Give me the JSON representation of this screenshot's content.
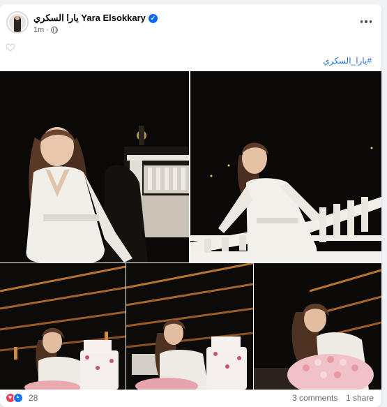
{
  "post": {
    "author_name": "يارا السكري Yara Elsokkary",
    "verified_mark": "✓",
    "time": "1m",
    "separator": "·",
    "hashtag": "#يارا_السكري",
    "more_icon": "more-options-icon",
    "privacy_icon": "globe-icon"
  },
  "photos": [
    {
      "label": "photo-1"
    },
    {
      "label": "photo-2"
    },
    {
      "label": "photo-3"
    },
    {
      "label": "photo-4"
    },
    {
      "label": "photo-5"
    }
  ],
  "footer": {
    "reaction_count": "28",
    "comments": "3 comments",
    "shares": "1 share"
  },
  "colors": {
    "link": "#216fdb",
    "verified": "#0866ff",
    "love": "#f33e58",
    "like": "#1877f2"
  }
}
